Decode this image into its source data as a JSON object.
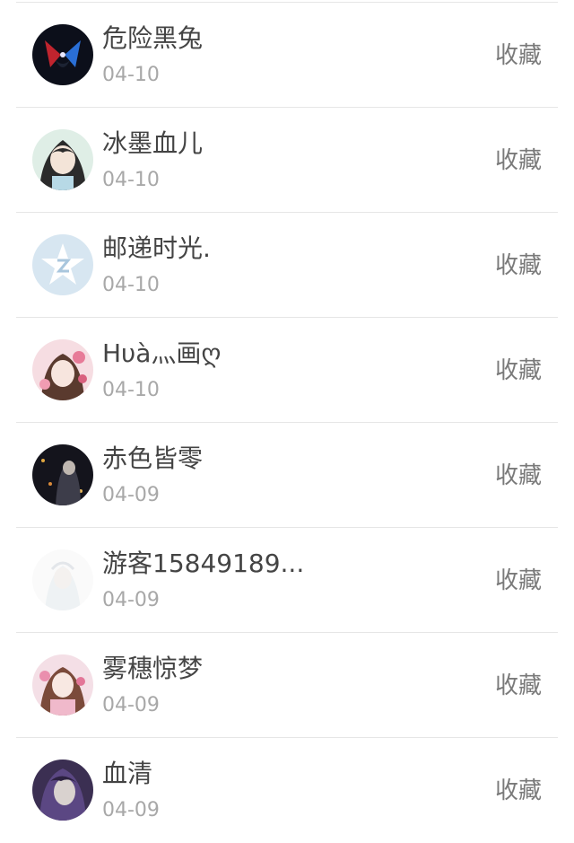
{
  "items": [
    {
      "name": "危险黑兔",
      "date": "04-10",
      "action": "收藏",
      "avatar": "dark-mask-avatar"
    },
    {
      "name": "冰墨血儿",
      "date": "04-10",
      "action": "收藏",
      "avatar": "anime-girl-avatar"
    },
    {
      "name": "邮递时光.",
      "date": "04-10",
      "action": "收藏",
      "avatar": "default-qq-avatar"
    },
    {
      "name": "Hυà灬画ღ",
      "date": "04-10",
      "action": "收藏",
      "avatar": "pink-flower-girl-avatar"
    },
    {
      "name": "赤色皆零",
      "date": "04-09",
      "action": "收藏",
      "avatar": "dark-night-figure-avatar"
    },
    {
      "name": "游客15849189...",
      "date": "04-09",
      "action": "收藏",
      "avatar": "faded-white-figure-avatar"
    },
    {
      "name": "雾穗惊梦",
      "date": "04-09",
      "action": "收藏",
      "avatar": "pink-anime-girl-avatar"
    },
    {
      "name": "血清",
      "date": "04-09",
      "action": "收藏",
      "avatar": "purple-hair-character-avatar"
    }
  ]
}
